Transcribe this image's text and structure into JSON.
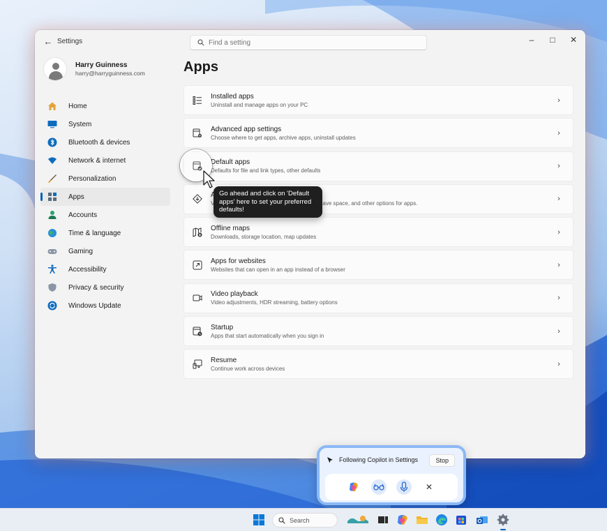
{
  "window": {
    "back_label": "←",
    "app_title": "Settings",
    "search_placeholder": "Find a setting",
    "minimize_label": "–",
    "maximize_label": "□",
    "close_label": "✕"
  },
  "profile": {
    "name": "Harry Guinness",
    "email": "harry@harryguinness.com"
  },
  "nav": {
    "items": [
      {
        "label": "Home",
        "icon": "home-icon"
      },
      {
        "label": "System",
        "icon": "monitor-icon"
      },
      {
        "label": "Bluetooth & devices",
        "icon": "bluetooth-icon"
      },
      {
        "label": "Network & internet",
        "icon": "wifi-icon"
      },
      {
        "label": "Personalization",
        "icon": "brush-icon"
      },
      {
        "label": "Apps",
        "icon": "apps-icon",
        "active": true
      },
      {
        "label": "Accounts",
        "icon": "person-icon"
      },
      {
        "label": "Time & language",
        "icon": "globe-clock-icon"
      },
      {
        "label": "Gaming",
        "icon": "gamepad-icon"
      },
      {
        "label": "Accessibility",
        "icon": "accessibility-icon"
      },
      {
        "label": "Privacy & security",
        "icon": "shield-icon"
      },
      {
        "label": "Windows Update",
        "icon": "update-icon"
      }
    ]
  },
  "page": {
    "title": "Apps"
  },
  "rows": [
    {
      "title": "Installed apps",
      "subtitle": "Uninstall and manage apps on your PC",
      "icon": "list-icon"
    },
    {
      "title": "Advanced app settings",
      "subtitle": "Choose where to get apps, archive apps, uninstall updates",
      "icon": "app-settings-icon"
    },
    {
      "title": "Default apps",
      "subtitle": "Defaults for file and link types, other defaults",
      "icon": "default-apps-icon"
    },
    {
      "title": "Apps for archiving",
      "subtitle": "View and manage apps that are archived to save space, and other options for apps.",
      "icon": "archive-icon"
    },
    {
      "title": "Offline maps",
      "subtitle": "Downloads, storage location, map updates",
      "icon": "map-icon"
    },
    {
      "title": "Apps for websites",
      "subtitle": "Websites that can open in an app instead of a browser",
      "icon": "open-link-icon"
    },
    {
      "title": "Video playback",
      "subtitle": "Video adjustments, HDR streaming, battery options",
      "icon": "video-icon"
    },
    {
      "title": "Startup",
      "subtitle": "Apps that start automatically when you sign in",
      "icon": "startup-icon"
    },
    {
      "title": "Resume",
      "subtitle": "Continue work across devices",
      "icon": "resume-icon"
    }
  ],
  "row_chevron": "›",
  "tooltip": {
    "text": "Go ahead and click on 'Default apps' here to set your preferred defaults!"
  },
  "copilot": {
    "status": "Following Copilot in Settings",
    "stop_label": "Stop",
    "close_label": "✕"
  },
  "taskbar": {
    "search_label": "Search"
  },
  "colors": {
    "accent": "#005fb8",
    "window_bg": "#f3f3f3",
    "card_bg": "#fbfbfb",
    "tooltip_bg": "#1f1f1f",
    "copilot_border": "#8cb8f5"
  }
}
